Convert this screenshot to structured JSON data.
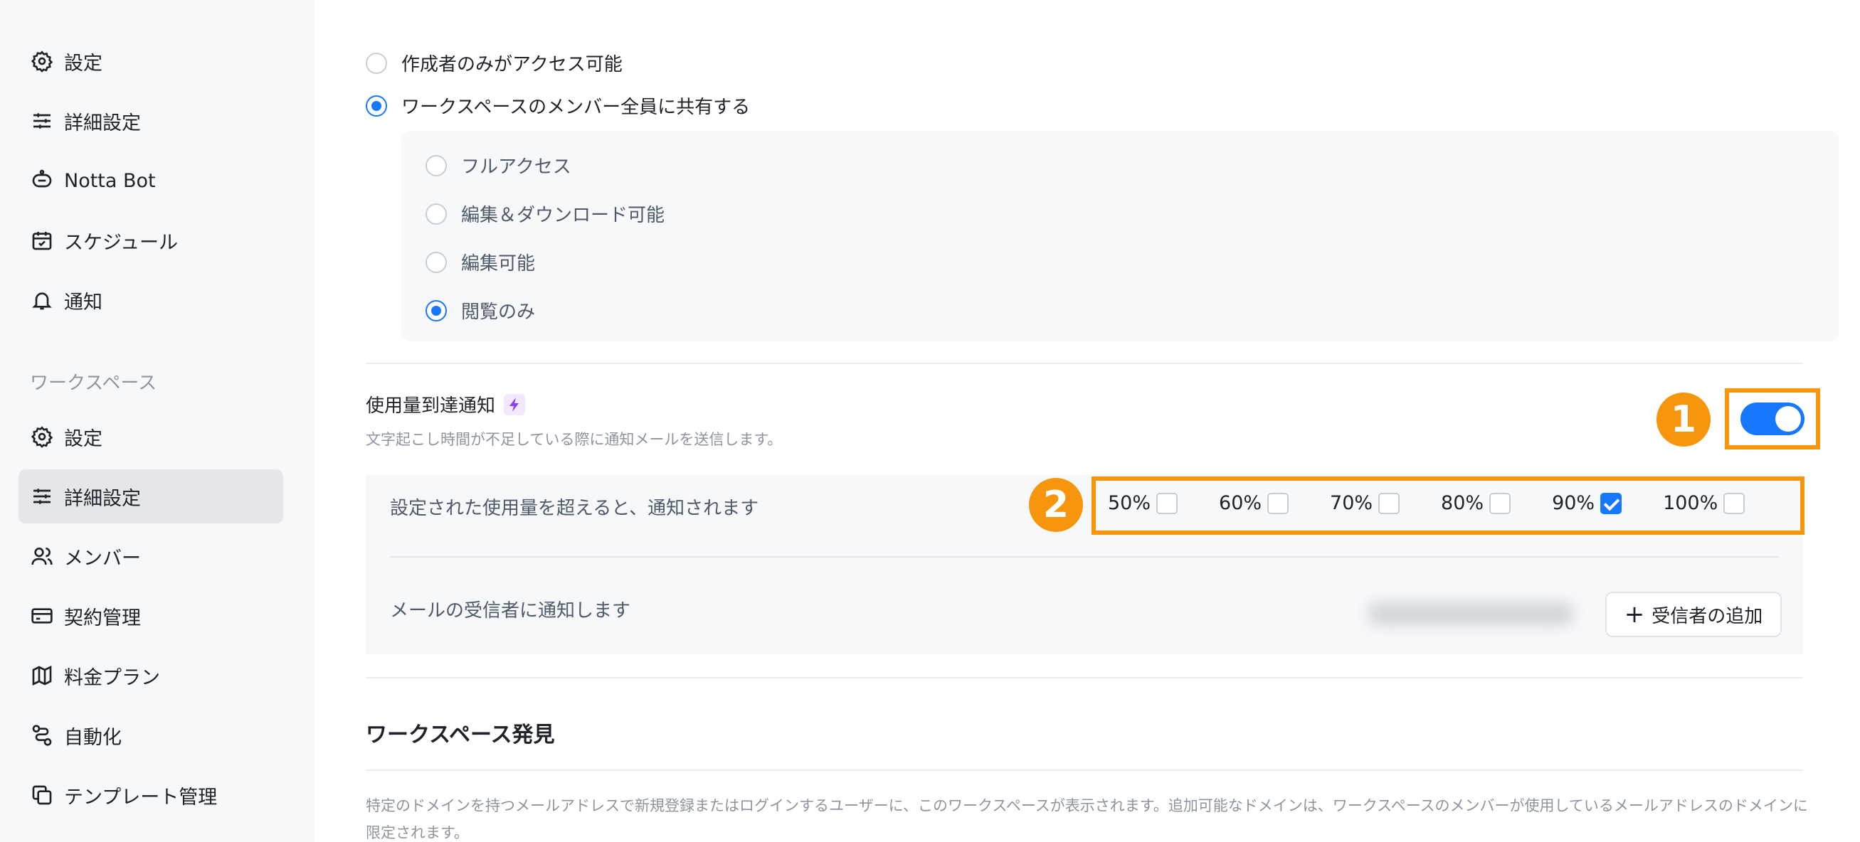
{
  "sidebar": {
    "items_top": [
      {
        "label": "設定",
        "icon": "gear-icon"
      },
      {
        "label": "詳細設定",
        "icon": "sliders-icon"
      },
      {
        "label": "Notta Bot",
        "icon": "bot-icon"
      },
      {
        "label": "スケジュール",
        "icon": "calendar-icon"
      },
      {
        "label": "通知",
        "icon": "bell-icon"
      }
    ],
    "section_title": "ワークスペース",
    "items_workspace": [
      {
        "label": "設定",
        "icon": "gear-icon"
      },
      {
        "label": "詳細設定",
        "icon": "sliders-icon",
        "active": true
      },
      {
        "label": "メンバー",
        "icon": "users-icon"
      },
      {
        "label": "契約管理",
        "icon": "card-icon"
      },
      {
        "label": "料金プラン",
        "icon": "map-icon"
      },
      {
        "label": "自動化",
        "icon": "flow-icon"
      },
      {
        "label": "テンプレート管理",
        "icon": "template-icon"
      }
    ]
  },
  "access": {
    "options": [
      {
        "label": "作成者のみがアクセス可能",
        "selected": false
      },
      {
        "label": "ワークスペースのメンバー全員に共有する",
        "selected": true
      }
    ],
    "permissions": [
      {
        "label": "フルアクセス",
        "selected": false
      },
      {
        "label": "編集＆ダウンロード可能",
        "selected": false
      },
      {
        "label": "編集可能",
        "selected": false
      },
      {
        "label": "閲覧のみ",
        "selected": true
      }
    ]
  },
  "usage_notify": {
    "title": "使用量到達通知",
    "description": "文字起こし時間が不足している際に通知メールを送信します。",
    "enabled": true,
    "threshold_label": "設定された使用量を超えると、通知されます",
    "thresholds": [
      {
        "label": "50%",
        "checked": false
      },
      {
        "label": "60%",
        "checked": false
      },
      {
        "label": "70%",
        "checked": false
      },
      {
        "label": "80%",
        "checked": false
      },
      {
        "label": "90%",
        "checked": true
      },
      {
        "label": "100%",
        "checked": false
      }
    ],
    "recipient_label": "メールの受信者に通知します",
    "add_recipient_label": "受信者の追加"
  },
  "annotations": {
    "badge1": "1",
    "badge2": "2",
    "color": "#f7950d"
  },
  "workspace_discovery": {
    "title": "ワークスペース発見",
    "description": "特定のドメインを持つメールアドレスで新規登録またはログインするユーザーに、このワークスペースが表示されます。追加可能なドメインは、ワークスペースのメンバーが使用しているメールアドレスのドメインに限定されます。"
  },
  "colors": {
    "accent": "#1677ff",
    "highlight": "#f7950d",
    "sidebar_bg": "#f7f8fa"
  }
}
